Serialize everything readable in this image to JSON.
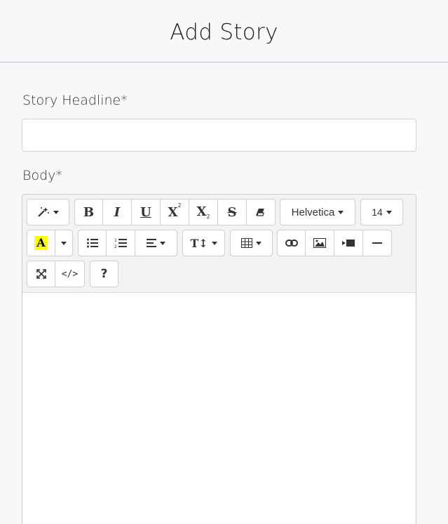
{
  "page": {
    "title": "Add Story"
  },
  "form": {
    "headline_label": "Story Headline*",
    "headline_value": "",
    "body_label": "Body*"
  },
  "toolbar": {
    "font_family": "Helvetica",
    "font_size": "14",
    "help_label": "?",
    "code_label": "</>",
    "icons": [
      "magic-wand",
      "bold",
      "italic",
      "underline",
      "superscript",
      "subscript",
      "strikethrough",
      "eraser",
      "font-family",
      "font-size",
      "highlight-color",
      "color-dropdown",
      "unordered-list",
      "ordered-list",
      "align",
      "line-height",
      "table",
      "link",
      "picture",
      "video",
      "horizontal-rule",
      "fullscreen",
      "code-view",
      "help"
    ]
  },
  "colors": {
    "highlight": "#ffff00",
    "background": "#f7f8fa"
  }
}
